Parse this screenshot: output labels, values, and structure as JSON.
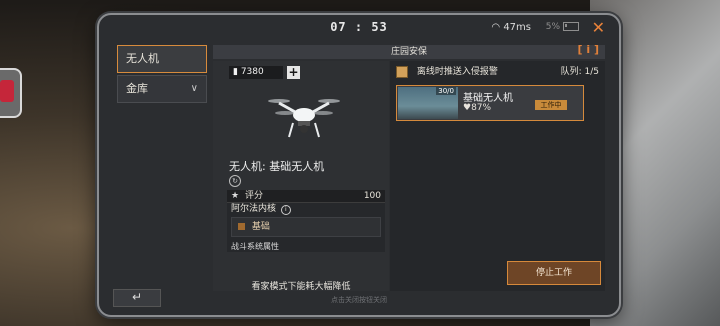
{
  "status": {
    "time": "07 : 53",
    "ping": "47ms",
    "battery": "5%"
  },
  "sidebar": {
    "items": [
      {
        "label": "无人机"
      },
      {
        "label": "金库"
      }
    ]
  },
  "header": {
    "title": "庄园安保",
    "info_icon": "[ i ]"
  },
  "drone": {
    "resource": "7380",
    "title": "无人机: 基础无人机",
    "score_label": "评分",
    "score_value": "100",
    "core_label": "阿尔法内核",
    "core_value": "基础",
    "combat_label": "战斗系统属性",
    "mode_note": "看家模式下能耗大幅降低"
  },
  "security": {
    "alert_label": "离线时推送入侵报警",
    "queue_label": "队列: 1/5",
    "card": {
      "count": "30/0",
      "name": "基础无人机",
      "health": "♥87%",
      "status": "工作中"
    },
    "stop_label": "停止工作"
  },
  "footer": {
    "hint": "点击关闭按钮关闭"
  }
}
